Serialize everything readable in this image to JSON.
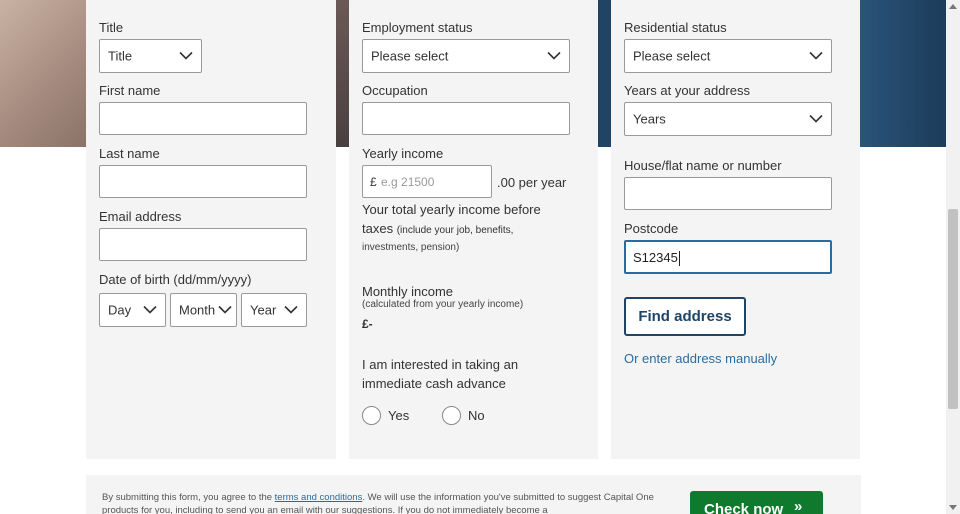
{
  "col1": {
    "title_label": "Title",
    "title_value": "Title",
    "first_name_label": "First name",
    "first_name_value": "",
    "last_name_label": "Last name",
    "last_name_value": "",
    "email_label": "Email address",
    "email_value": "",
    "dob_label": "Date of birth (dd/mm/yyyy)",
    "dob_day": "Day",
    "dob_month": "Month",
    "dob_year": "Year"
  },
  "col2": {
    "employment_label": "Employment status",
    "employment_value": "Please select",
    "occupation_label": "Occupation",
    "occupation_value": "",
    "yearly_income_label": "Yearly income",
    "currency_symbol": "£",
    "yearly_income_placeholder": "e.g 21500",
    "per_year_suffix": ".00 per year",
    "help_line1": "Your total yearly income before",
    "help_line2_main": "taxes",
    "help_line2_small": "(include your job, benefits,",
    "help_line3_small": "investments, pension)",
    "monthly_label": "Monthly income",
    "monthly_sub": "(calculated from your yearly income)",
    "monthly_value": "£-",
    "cash_line1": "I am interested in taking an",
    "cash_line2": "immediate cash advance",
    "yes_label": "Yes",
    "no_label": "No"
  },
  "col3": {
    "residential_label": "Residential status",
    "residential_value": "Please select",
    "years_label": "Years at your address",
    "years_value": "Years",
    "house_label": "House/flat name or number",
    "house_value": "",
    "postcode_label": "Postcode",
    "postcode_value": "S12345",
    "find_address_label": "Find address",
    "manual_link": "Or enter address manually"
  },
  "footer": {
    "text_before": "By submitting this form, you agree to the ",
    "terms_link": "terms and conditions",
    "text_after": ". We will use the information you've submitted to suggest Capital One products for you, including to send you an email with our suggestions. If you do not immediately become a",
    "cta_label": "Check now",
    "cta_icon": "»"
  },
  "colors": {
    "accent_blue": "#1f4466",
    "link_blue": "#2a6ca0",
    "cta_green": "#0f7a2e",
    "panel_bg": "#f4f4f4"
  }
}
